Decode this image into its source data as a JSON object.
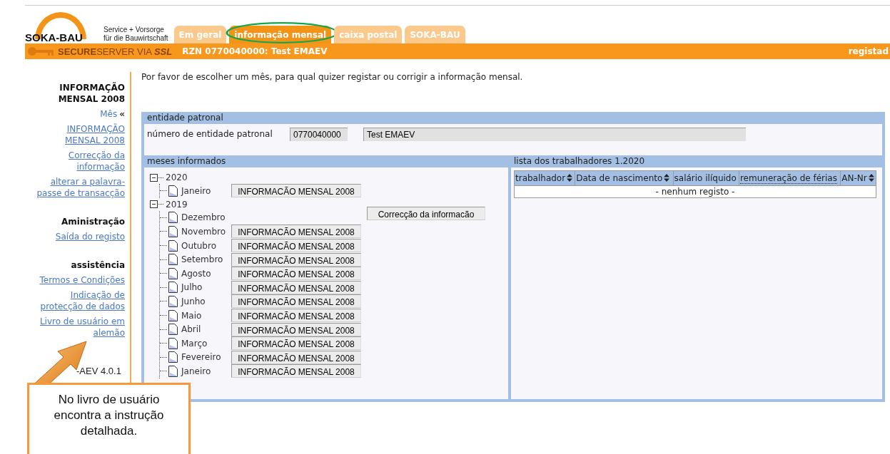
{
  "header": {
    "logo": "SOKA-BAU",
    "tagline": [
      "Service + Vorsorge",
      "für die Bauwirtschaft"
    ]
  },
  "tabs": [
    {
      "label": "Em geral",
      "selected": false
    },
    {
      "label": "informação mensal",
      "selected": true,
      "highlighted": true
    },
    {
      "label": "caixa postal",
      "selected": false
    },
    {
      "label": "SOKA-BAU",
      "selected": false
    }
  ],
  "secure_bar": {
    "brand": "**SECURE**SERVER VIA **SSL**",
    "account": "RZN 0770040000: Test EMAEV",
    "status": "registad"
  },
  "sidebar": [
    {
      "title": "INFORMAÇÃO MENSAL 2008",
      "items": [
        {
          "label": "Mês",
          "link": false,
          "marker": "«"
        },
        {
          "label": "INFORMAÇÃO MENSAL 2008",
          "link": true
        },
        {
          "label": "Correcção da informação",
          "link": true
        },
        {
          "label": "alterar a palavra-passe de transacção",
          "link": true
        }
      ]
    },
    {
      "title": "Aministração",
      "items": [
        {
          "label": "Saída do registo",
          "link": true
        }
      ]
    },
    {
      "title": "assistência",
      "items": [
        {
          "label": "Termos e Condições",
          "link": true
        },
        {
          "label": "Indicação de protecção de dados",
          "link": true
        },
        {
          "label": "Livro de usuário em alemão",
          "link": true
        }
      ]
    }
  ],
  "version": "-AEV 4.0.1",
  "intro": "Por favor de escolher um mês, para qual quizer registar ou corrigir a informação mensal.",
  "employer": {
    "heading": "entidade patronal",
    "label": "número de entidade patronal",
    "number": "0770040000",
    "name": "Test EMAEV"
  },
  "months": {
    "heading": "meses informados",
    "years": [
      {
        "label": "2020",
        "expanded": true,
        "children": [
          {
            "label": "Janeiro",
            "kind": "report",
            "button": "INFORMACÃO MENSAL 2008"
          }
        ]
      },
      {
        "label": "2019",
        "expanded": true,
        "children": [
          {
            "label": "Dezembro",
            "kind": "correction",
            "button": "Correcção da informacão"
          },
          {
            "label": "Novembro",
            "kind": "report",
            "button": "INFORMACÃO MENSAL 2008"
          },
          {
            "label": "Outubro",
            "kind": "report",
            "button": "INFORMACÃO MENSAL 2008"
          },
          {
            "label": "Setembro",
            "kind": "report",
            "button": "INFORMACÃO MENSAL 2008"
          },
          {
            "label": "Agosto",
            "kind": "report",
            "button": "INFORMACÃO MENSAL 2008"
          },
          {
            "label": "Julho",
            "kind": "report",
            "button": "INFORMACÃO MENSAL 2008"
          },
          {
            "label": "Junho",
            "kind": "report",
            "button": "INFORMACÃO MENSAL 2008"
          },
          {
            "label": "Maio",
            "kind": "report",
            "button": "INFORMACÃO MENSAL 2008"
          },
          {
            "label": "Abril",
            "kind": "report",
            "button": "INFORMACÃO MENSAL 2008"
          },
          {
            "label": "Março",
            "kind": "report",
            "button": "INFORMACÃO MENSAL 2008"
          },
          {
            "label": "Fevereiro",
            "kind": "report",
            "button": "INFORMACÃO MENSAL 2008"
          },
          {
            "label": "Janeiro",
            "kind": "report",
            "button": "INFORMACÃO MENSAL 2008"
          }
        ]
      }
    ]
  },
  "workers": {
    "heading": "lista dos trabalhadores 1.2020",
    "columns": [
      {
        "label": "trabalhador",
        "sortable": true
      },
      {
        "label": "Data de nascimento",
        "sortable": true
      },
      {
        "label": "salário ilíquido",
        "sortable": false
      },
      {
        "label": "remuneração de férias",
        "sortable": false,
        "tooltip": true
      },
      {
        "label": "AN-Nr",
        "sortable": true
      }
    ],
    "empty": "- nenhum registo -"
  },
  "callout": "No livro de usuário encontra a instrução detalhada."
}
